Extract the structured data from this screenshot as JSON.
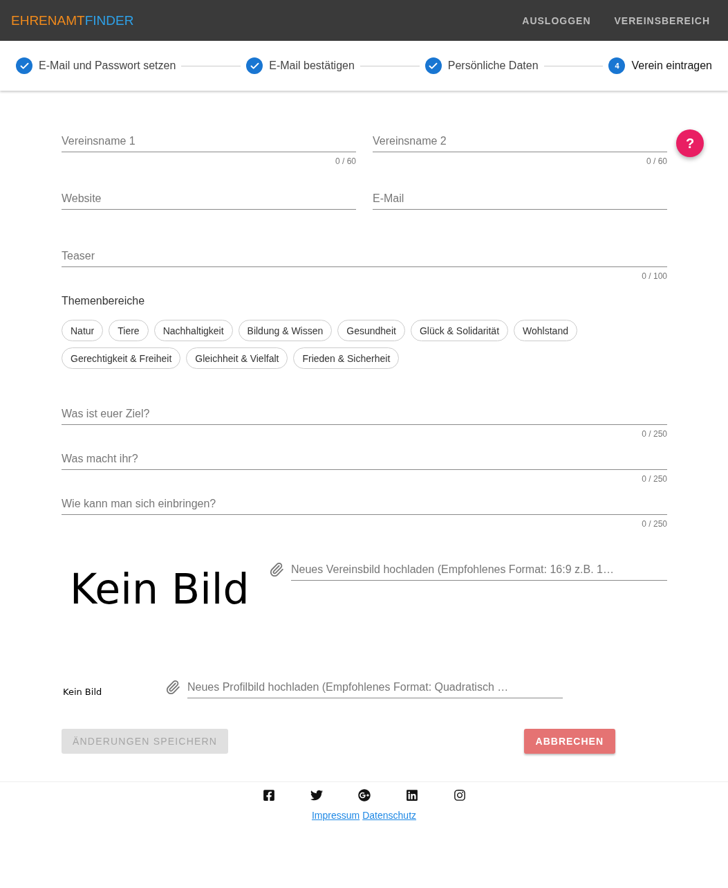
{
  "header": {
    "logo": {
      "part_1": "EHRENAMT",
      "part_2": "FINDER"
    },
    "nav": [
      "AUSLOGGEN",
      "VEREINSBEREICH"
    ]
  },
  "stepper": [
    {
      "label": "E-Mail und Passwort setzen",
      "done": true
    },
    {
      "label": "E-Mail bestätigen",
      "done": true
    },
    {
      "label": "Persönliche Daten",
      "done": true
    },
    {
      "label": "Verein eintragen",
      "done": false,
      "number": "4"
    }
  ],
  "help_button": "?",
  "fields_row_1": [
    {
      "placeholder": "Vereinsname 1",
      "counter": "0 / 60"
    },
    {
      "placeholder": "Vereinsname 2",
      "counter": "0 / 60"
    }
  ],
  "fields_row_2": [
    {
      "placeholder": "Website"
    },
    {
      "placeholder": "E-Mail"
    }
  ],
  "teaser": {
    "placeholder": "Teaser",
    "counter": "0 / 100"
  },
  "topics": {
    "label": "Themenbereiche",
    "chips": [
      {
        "label": "Natur",
        "selected": false
      },
      {
        "label": "Tiere",
        "selected": false
      },
      {
        "label": "Nachhaltigkeit",
        "selected": false
      },
      {
        "label": "Bildung & Wissen",
        "selected": false
      },
      {
        "label": "Gesundheit",
        "selected": false
      },
      {
        "label": "Glück & Solidarität",
        "selected": false
      },
      {
        "label": "Wohlstand",
        "selected": false
      },
      {
        "label": "Gerechtigkeit & Freiheit",
        "selected": false
      },
      {
        "label": "Gleichheit & Vielfalt",
        "selected": false
      },
      {
        "label": "Frieden & Sicherheit",
        "selected": false
      }
    ]
  },
  "questions": [
    {
      "placeholder": "Was ist euer Ziel?",
      "counter": "0 / 250"
    },
    {
      "placeholder": "Was macht ihr?",
      "counter": "0 / 250"
    },
    {
      "placeholder": "Wie kann man sich einbringen?",
      "counter": "0 / 250"
    }
  ],
  "club_image": {
    "preview": "Kein Bild",
    "upload_placeholder": "Neues Vereinsbild hochladen (Empfohlenes Format: 16:9 z.B. 1…"
  },
  "profile_image": {
    "preview": "Kein Bild",
    "upload_placeholder": "Neues Profilbild hochladen (Empfohlenes Format: Quadratisch …"
  },
  "buttons": {
    "save": {
      "label": "ÄNDERUNGEN SPEICHERN",
      "disabled": true
    },
    "cancel": {
      "label": "ABBRECHEN"
    }
  },
  "footer": {
    "links": [
      "Impressum",
      "Datenschutz"
    ]
  }
}
